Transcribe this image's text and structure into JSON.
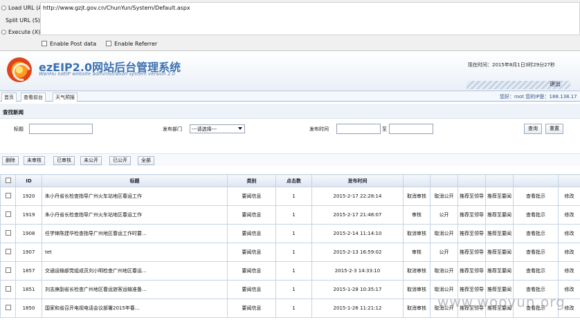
{
  "hackbar": {
    "buttons": [
      "Load URL (A)",
      "Split URL (S)",
      "Execute (X)"
    ],
    "url": "http://www.gzjt.gov.cn/ChunYun/System/Default.aspx",
    "options": [
      "Enable Post data",
      "Enable Referrer"
    ]
  },
  "header": {
    "title": "ezEIP2.0网站后台管理系统",
    "subtitle": "WanHu ezEIP website administration system version 2.0",
    "now_time": "现在时间：2015年8月1日3时29分27秒",
    "exit": "退出"
  },
  "nav": {
    "tabs": [
      "首页",
      "查看前台",
      "天气预报"
    ],
    "user_info": "您好：root 您的IP是：188.138.17"
  },
  "search": {
    "title": "查找新闻",
    "title_label": "标题",
    "dept_label": "发布部门",
    "dept_selected": "---请选择---",
    "time_label": "发布时间",
    "to_label": "至",
    "query_btn": "查询",
    "reset_btn": "重置"
  },
  "ops": [
    "删除",
    "未审核",
    "已审核",
    "未公开",
    "已公开",
    "全部"
  ],
  "table": {
    "headers": [
      "",
      "ID",
      "标题",
      "类别",
      "点击数",
      "发布时间",
      "",
      "",
      "",
      "",
      "",
      ""
    ],
    "rows": [
      {
        "id": "1920",
        "title": "朱小丹省长检查指导广州火车站地区春运工作",
        "category": "要闻信息",
        "clicks": "1",
        "time": "2015-2-17 22:28:14",
        "audit": "取消审核",
        "pub": "取消公开",
        "lead": "推荐至领导",
        "leader": "推荐至要闻",
        "view": "查看批示",
        "edit": "修改"
      },
      {
        "id": "1919",
        "title": "朱小丹省长检查指导广州火车站地区春运工作",
        "category": "要闻信息",
        "clicks": "1",
        "time": "2015-2-17 21:48:07",
        "audit": "审核",
        "pub": "公开",
        "lead": "推荐至领导",
        "leader": "推荐至要闻",
        "view": "查看批示",
        "edit": "修改"
      },
      {
        "id": "1908",
        "title": "任学锋陈建华检查指导广州地区春运工作时要...",
        "category": "要闻信息",
        "clicks": "1",
        "time": "2015-2-14 11:14:10",
        "audit": "取消审核",
        "pub": "取消公开",
        "lead": "推荐至领导",
        "leader": "推荐至要闻",
        "view": "查看批示",
        "edit": "修改"
      },
      {
        "id": "1907",
        "title": "tet",
        "category": "要闻信息",
        "clicks": "1",
        "time": "2015-2-13 16:59:02",
        "audit": "审核",
        "pub": "公开",
        "lead": "推荐至领导",
        "leader": "推荐至要闻",
        "view": "查看批示",
        "edit": "修改"
      },
      {
        "id": "1857",
        "title": "交通运输部党组成员刘小明检查广州地区春运...",
        "category": "要闻信息",
        "clicks": "1",
        "time": "2015-2-3 14:33:10",
        "audit": "取消审核",
        "pub": "取消公开",
        "lead": "推荐至领导",
        "leader": "推荐至要闻",
        "view": "查看批示",
        "edit": "修改"
      },
      {
        "id": "1851",
        "title": "刘志庚副省长检查广州地区春运旅客运输准备...",
        "category": "要闻信息",
        "clicks": "1",
        "time": "2015-1-28 10:35:17",
        "audit": "取消审核",
        "pub": "取消公开",
        "lead": "推荐至领导",
        "leader": "推荐至要闻",
        "view": "查看批示",
        "edit": "修改"
      },
      {
        "id": "1850",
        "title": "国家和省召开电视电话会议部署2015年春...",
        "category": "要闻信息",
        "clicks": "1",
        "time": "2015-1-26 11:21:12",
        "audit": "取消审核",
        "pub": "取消公开",
        "lead": "推荐至领导",
        "leader": "推荐至要闻",
        "view": "查看批示",
        "edit": "修改"
      }
    ]
  },
  "watermark": "www.wooyun.org"
}
